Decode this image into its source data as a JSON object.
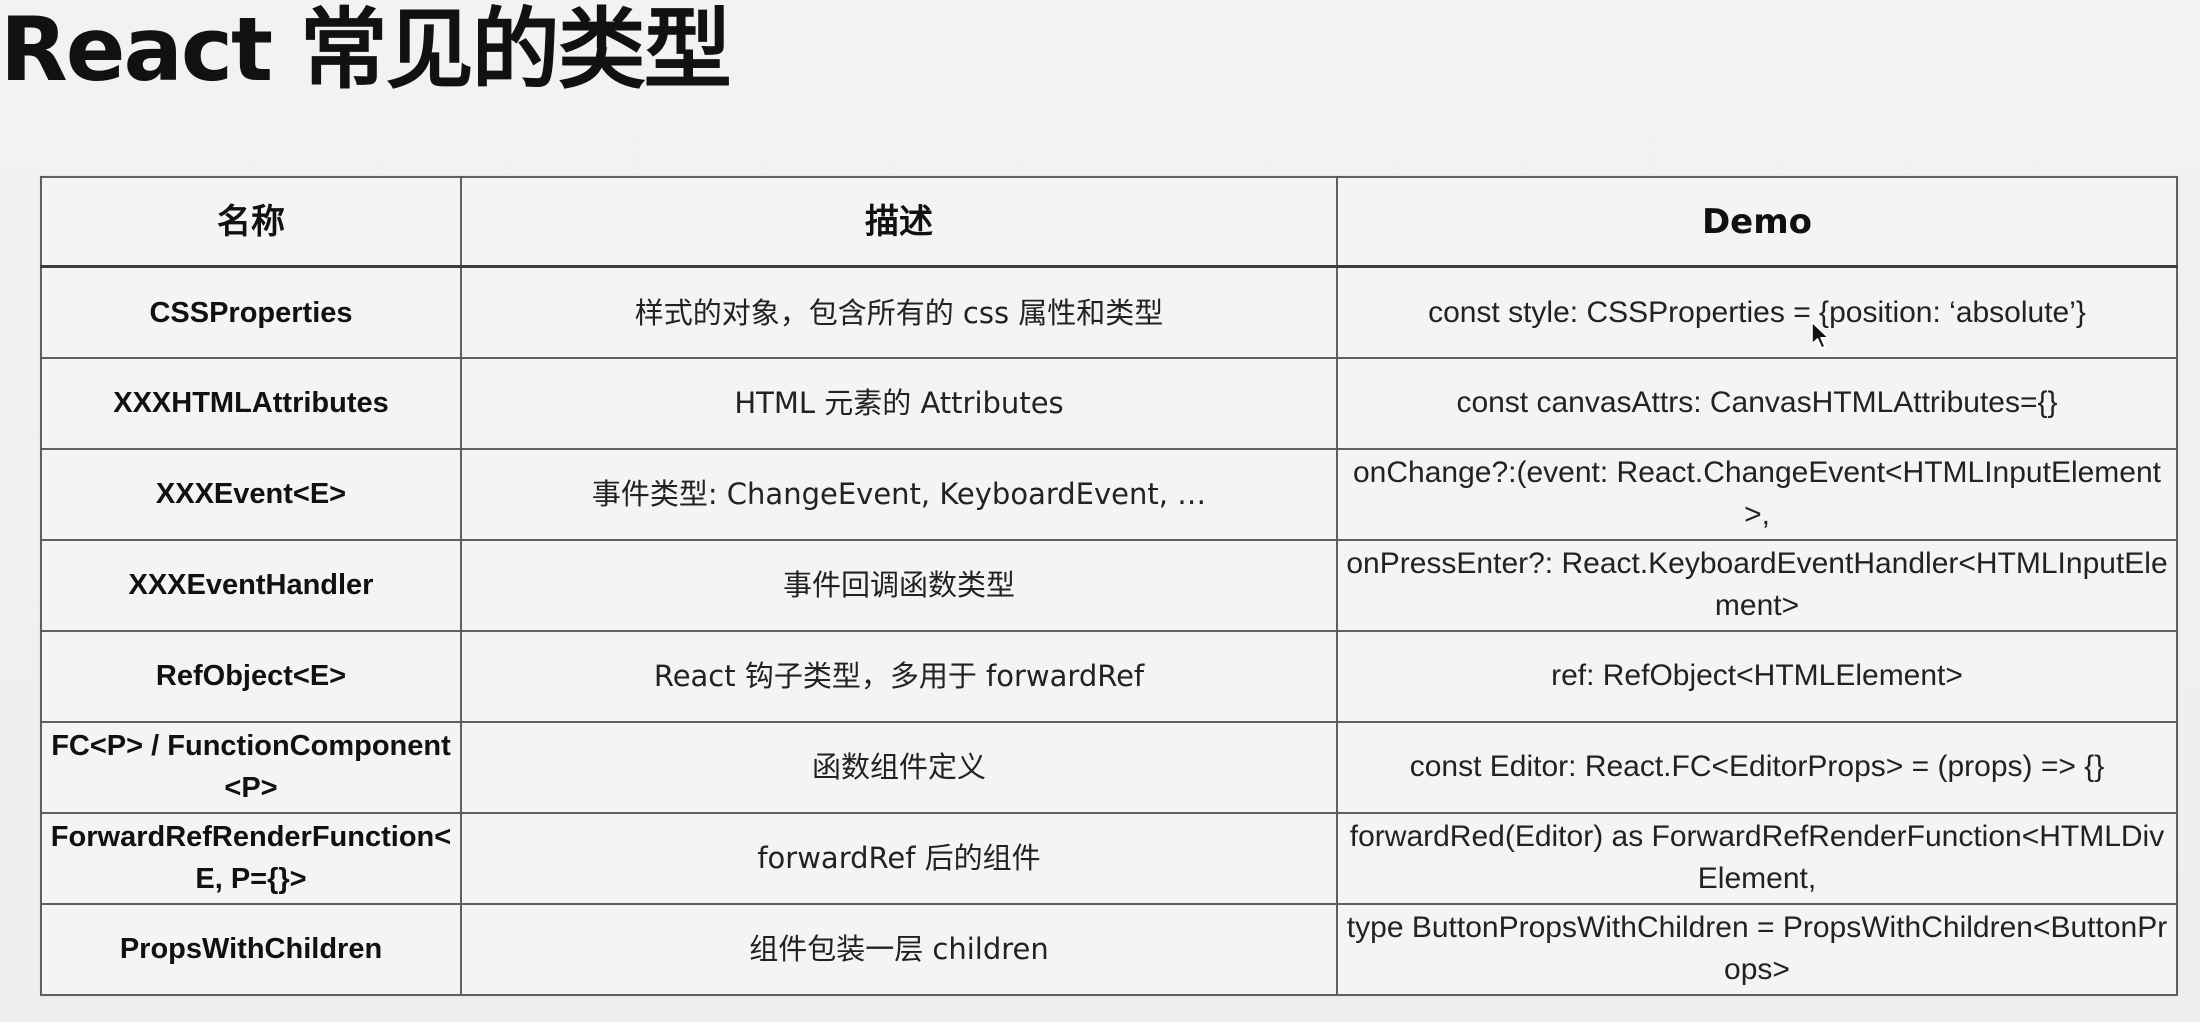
{
  "page": {
    "title": "React 常见的类型"
  },
  "table": {
    "headers": {
      "name": "名称",
      "description": "描述",
      "demo": "Demo"
    },
    "rows": [
      {
        "name": "CSSProperties",
        "description": "样式的对象，包含所有的 css 属性和类型",
        "demo": "const style: CSSProperties = {position: ‘absolute’}"
      },
      {
        "name": "XXXHTMLAttributes",
        "description": "HTML 元素的 Attributes",
        "demo": "const canvasAttrs: CanvasHTMLAttributes={}"
      },
      {
        "name": "XXXEvent<E>",
        "description": "事件类型: ChangeEvent, KeyboardEvent, …",
        "demo": "onChange?:(event: React.ChangeEvent<HTMLInputElement>,"
      },
      {
        "name": "XXXEventHandler",
        "description": "事件回调函数类型",
        "demo": "onPressEnter?: React.KeyboardEventHandler<HTMLInputElement>"
      },
      {
        "name": "RefObject<E>",
        "description": "React 钩子类型，多用于 forwardRef",
        "demo": "ref: RefObject<HTMLElement>"
      },
      {
        "name": "FC<P> / FunctionComponent<P>",
        "description": "函数组件定义",
        "demo": "const Editor: React.FC<EditorProps> = (props) => {}"
      },
      {
        "name": "ForwardRefRenderFunction<E, P={}>",
        "description": "forwardRef 后的组件",
        "demo": "forwardRed(Editor) as ForwardRefRenderFunction<HTMLDivElement,"
      },
      {
        "name": "PropsWithChildren",
        "description": "组件包装一层 children",
        "demo": "type ButtonPropsWithChildren = PropsWithChildren<ButtonProps>"
      }
    ]
  },
  "cursor": {
    "icon": "mouse-pointer-icon"
  }
}
